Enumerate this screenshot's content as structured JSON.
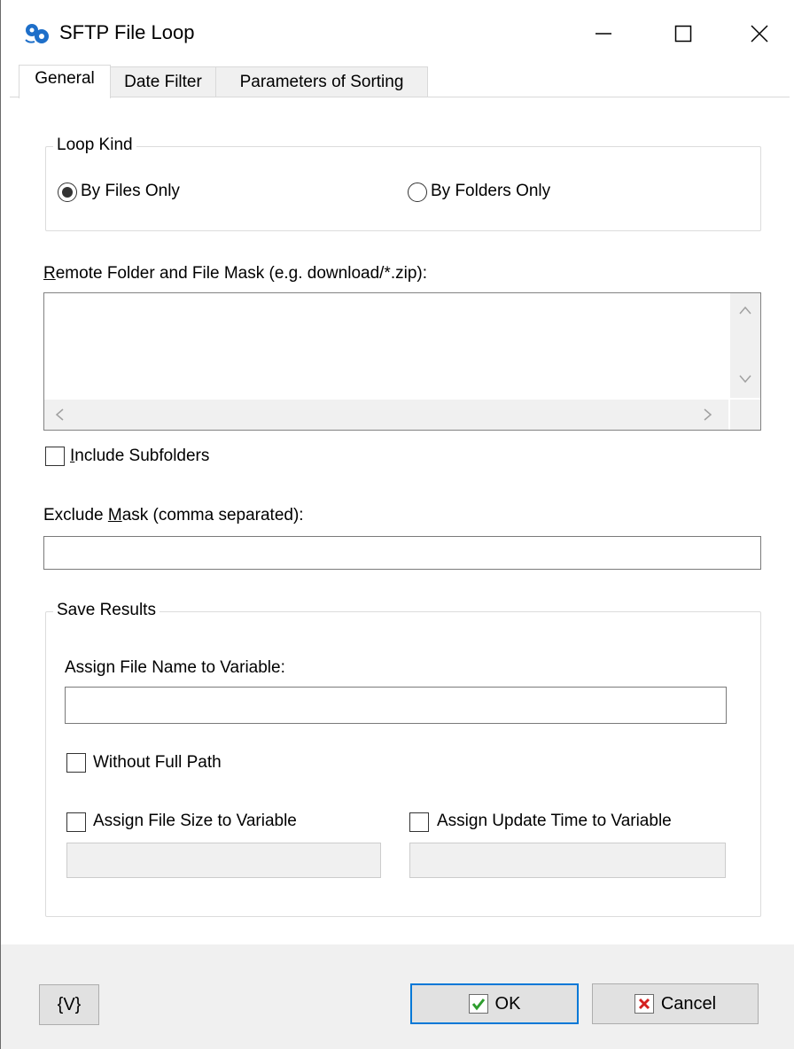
{
  "window": {
    "title": "SFTP File Loop",
    "icon": "sftp-gears-icon",
    "controls": {
      "minimize": "minimize-icon",
      "maximize": "maximize-icon",
      "close": "close-icon"
    }
  },
  "tabs": [
    {
      "label": "General",
      "active": true
    },
    {
      "label": "Date Filter",
      "active": false
    },
    {
      "label": "Parameters of Sorting",
      "active": false
    }
  ],
  "loop_kind": {
    "legend": "Loop Kind",
    "options": [
      {
        "label": "By Files Only",
        "checked": true
      },
      {
        "label": "By Folders Only",
        "checked": false
      }
    ]
  },
  "remote_folder": {
    "label_first": "R",
    "label_rest": "emote Folder and File Mask (e.g. download/*.zip):",
    "value": ""
  },
  "include_subfolders": {
    "label_first": "I",
    "label_rest": "nclude Subfolders",
    "checked": false
  },
  "exclude_mask": {
    "label_pre": "Exclude ",
    "label_underlined": "M",
    "label_post": "ask (comma separated):",
    "value": ""
  },
  "save_results": {
    "legend": "Save Results",
    "assign_file_name_label": "Assign File Name to Variable:",
    "assign_file_name_value": "",
    "without_full_path": {
      "label": "Without Full Path",
      "checked": false
    },
    "assign_file_size": {
      "label": "Assign File Size to Variable",
      "checked": false,
      "value": ""
    },
    "assign_update_time": {
      "label": "Assign Update Time to Variable",
      "checked": false,
      "value": ""
    }
  },
  "footer": {
    "variables_button": "{V}",
    "ok_button": "OK",
    "cancel_button": "Cancel",
    "accent": "#0078d7",
    "ok_icon_color": "#2e9d2e",
    "cancel_icon_color": "#d42020"
  }
}
